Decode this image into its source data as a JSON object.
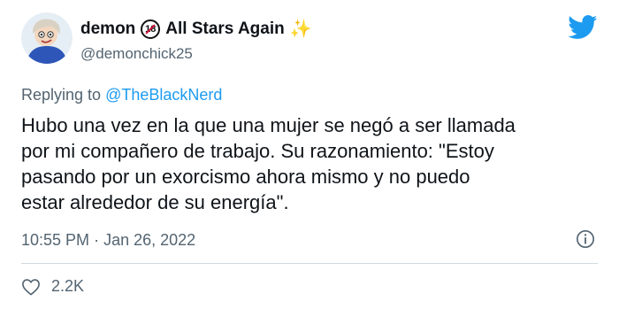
{
  "tweet": {
    "display_name": "demon",
    "name_suffix": "All Stars Again",
    "badge_text": "18",
    "handle": "@demonchick25",
    "replying_prefix": "Replying to",
    "replying_to": "@TheBlackNerd",
    "body": "Hubo una vez en la que una mujer se negó a ser llamada\npor mi compañero de trabajo. Su razonamiento: \"Estoy\npasando por un exorcismo ahora mismo y no puedo\nestar alrededor de su energía\".",
    "time": "10:55 PM",
    "separator": "·",
    "date": "Jan 26, 2022",
    "likes": "2.2K"
  },
  "colors": {
    "accent": "#1d9bf0",
    "secondary_text": "#536471",
    "primary_text": "#0f1419",
    "divider": "#cfd9de"
  },
  "icons": [
    "twitter-bird-icon",
    "info-icon",
    "heart-icon",
    "sparkles-icon",
    "no-under-18-icon"
  ]
}
